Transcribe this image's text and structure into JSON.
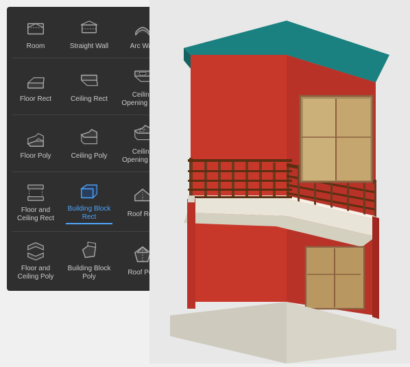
{
  "toolbar": {
    "items": [
      {
        "id": "room",
        "label": "Room",
        "icon": "room",
        "active": false
      },
      {
        "id": "straight-wall",
        "label": "Straight Wall",
        "icon": "straight-wall",
        "active": false
      },
      {
        "id": "arc-wall",
        "label": "Arc Wall",
        "icon": "arc-wall",
        "active": false
      },
      {
        "id": "floor-rect",
        "label": "Floor Rect",
        "icon": "floor-rect",
        "active": false
      },
      {
        "id": "ceiling-rect",
        "label": "Ceiling Rect",
        "icon": "ceiling-rect",
        "active": false
      },
      {
        "id": "ceiling-opening-rect",
        "label": "Ceiling Opening Rect",
        "icon": "ceiling-opening-rect",
        "active": false
      },
      {
        "id": "floor-poly",
        "label": "Floor Poly",
        "icon": "floor-poly",
        "active": false
      },
      {
        "id": "ceiling-poly",
        "label": "Ceiling Poly",
        "icon": "ceiling-poly",
        "active": false
      },
      {
        "id": "ceiling-opening-poly",
        "label": "Ceiling Opening Poly",
        "icon": "ceiling-opening-poly",
        "active": false
      },
      {
        "id": "floor-ceiling-rect",
        "label": "Floor and Ceiling Rect",
        "icon": "floor-ceiling-rect",
        "active": false
      },
      {
        "id": "building-block-rect",
        "label": "Building Block Rect",
        "icon": "building-block-rect",
        "active": true
      },
      {
        "id": "roof-rect",
        "label": "Roof Rect",
        "icon": "roof-rect",
        "active": false
      },
      {
        "id": "floor-ceiling-poly",
        "label": "Floor and Ceiling Poly",
        "icon": "floor-ceiling-poly",
        "active": false
      },
      {
        "id": "building-block-poly",
        "label": "Building Block Poly",
        "icon": "building-block-poly",
        "active": false
      },
      {
        "id": "roof-poly",
        "label": "Roof Poly",
        "icon": "roof-poly",
        "active": false
      }
    ]
  }
}
